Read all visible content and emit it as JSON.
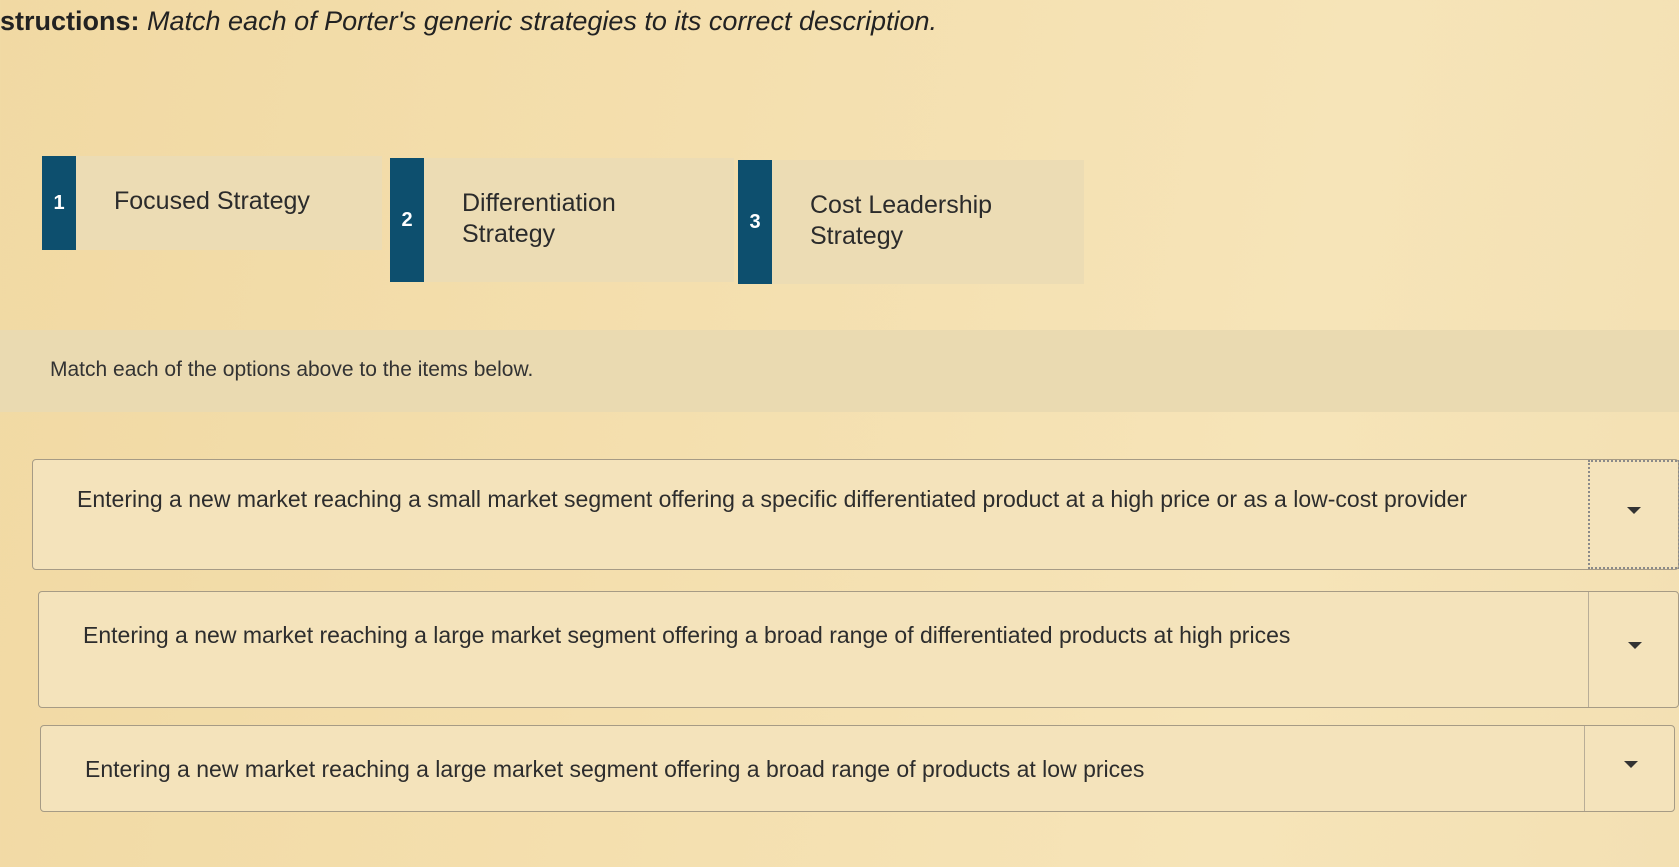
{
  "instructions": {
    "lead": "structions:",
    "text": " Match each of Porter's generic strategies to its correct description."
  },
  "options": [
    {
      "number": "1",
      "label_line1": "Focused Strategy",
      "label_line2": ""
    },
    {
      "number": "2",
      "label_line1": "Differentiation",
      "label_line2": "Strategy"
    },
    {
      "number": "3",
      "label_line1": "Cost Leadership",
      "label_line2": "Strategy"
    }
  ],
  "match_prompt": "Match each of the options above to the items below.",
  "items": [
    {
      "text": "Entering a new market reaching a small market segment offering a specific differentiated product at a high price or as a low-cost provider",
      "selected": ""
    },
    {
      "text": "Entering a new market reaching a large market segment offering a broad range of differentiated products at high prices",
      "selected": ""
    },
    {
      "text": "Entering a new market reaching a large market segment offering a broad range of products at low prices",
      "selected": ""
    }
  ],
  "colors": {
    "badge": "#0d4f6e",
    "background": "#f4dfae"
  }
}
